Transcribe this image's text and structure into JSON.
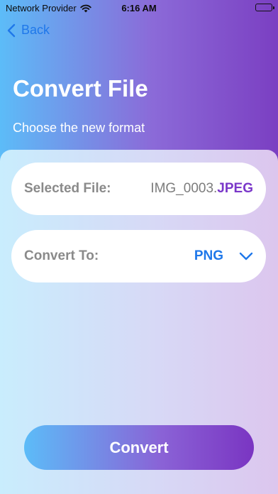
{
  "status_bar": {
    "carrier": "Network Provider",
    "time": "6:16 AM",
    "wifi_icon": "wifi-icon",
    "battery_icon": "battery-icon"
  },
  "nav": {
    "back_label": "Back",
    "back_icon": "chevron-left-icon"
  },
  "header": {
    "title": "Convert File",
    "subtitle": "Choose the new format"
  },
  "selected_file": {
    "label": "Selected File:",
    "name": "IMG_0003.",
    "extension": "JPEG"
  },
  "convert_to": {
    "label": "Convert To:",
    "value": "PNG",
    "dropdown_icon": "chevron-down-icon"
  },
  "actions": {
    "convert_label": "Convert"
  },
  "colors": {
    "accent_blue": "#1f78ea",
    "accent_purple": "#7a37c9",
    "gradient_start": "#5cbcf8",
    "gradient_end": "#7b3fc2"
  }
}
